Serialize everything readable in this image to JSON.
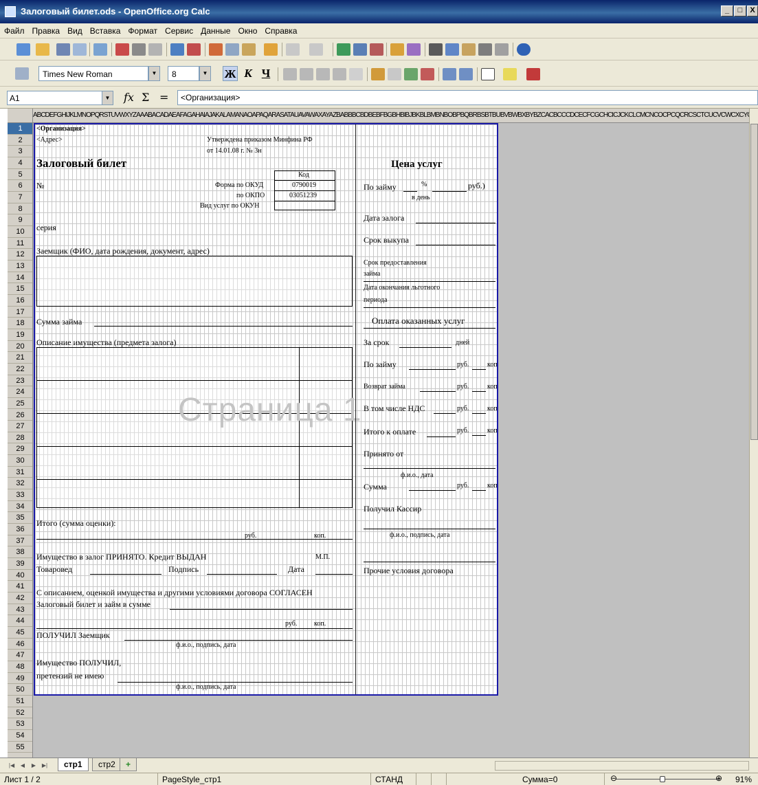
{
  "window": {
    "title": "Залоговый билет.ods - OpenOffice.org Calc",
    "min": "_",
    "max": "□",
    "close": "X"
  },
  "menu": [
    "Файл",
    "Правка",
    "Вид",
    "Вставка",
    "Формат",
    "Сервис",
    "Данные",
    "Окно",
    "Справка"
  ],
  "format_toolbar": {
    "font_name": "Times New Roman",
    "font_size": "8",
    "bold": "Ж",
    "italic": "К",
    "underline": "Ч"
  },
  "formula_bar": {
    "cell_ref": "A1",
    "fx": "fx",
    "sum": "Σ",
    "equals": "=",
    "content": "<Организация>"
  },
  "column_header_text": "ABCDEFGHIJKLMNOPQRSTUVWXYZAAABACADAEAFAGAHAIAJAKALAMANAOAPAQARASATAUAVAWAXAYAZBABBBCBDBEBFBGBHBIBJBKBLBMBNBOBPBQBRBSBTBUBVBWBXBYBZCACBCCCDCECFCGCHCICJCKCLCMCNCOCPCQCRCSCTCUCVCWCXCYCZDADBDCDDDEDFDGDHDIDJDKDLDMDNDODPDQDRDSDTDUDVDWDXDYDZEAEBECEDEEEFEGEHEIEJEKELEMENEOEPEQERESETEUEVEWEXEYEZ",
  "rows": [
    "1",
    "2",
    "3",
    "4",
    "5",
    "6",
    "7",
    "8",
    "9",
    "10",
    "11",
    "12",
    "13",
    "14",
    "15",
    "16",
    "17",
    "18",
    "19",
    "20",
    "21",
    "22",
    "23",
    "24",
    "25",
    "26",
    "27",
    "28",
    "29",
    "30",
    "31",
    "32",
    "33",
    "34",
    "35",
    "36",
    "37",
    "38",
    "39",
    "40",
    "41",
    "42",
    "43",
    "44",
    "45",
    "46",
    "47",
    "48",
    "49",
    "50",
    "51",
    "52",
    "53",
    "54",
    "55"
  ],
  "form": {
    "org": "<Организация>",
    "addr": "<Адрес>",
    "approved1": "Утверждена приказом Минфина РФ",
    "approved2": "от 14.01.08 г. № 3н",
    "title": "Залоговый билет",
    "kod": "Код",
    "num": "№",
    "okud_label": "Форма по ОКУД",
    "okud_val": "0790019",
    "okpo_label": "по ОКПО",
    "okpo_val": "03051239",
    "okun_label": "Вид услуг по ОКУН",
    "series": "серия",
    "borrower": "Заемщик (ФИО, дата рождения, документ, адрес)",
    "loan_sum": "Сумма займа",
    "desc": "Описание имущества (предмета залога)",
    "watermark": "Страница 1",
    "total": "Итого (сумма оценки):",
    "rub": "руб.",
    "kop": "коп.",
    "accepted": "Имущество в залог ПРИНЯТО. Кредит ВЫДАН",
    "mp": "М.П.",
    "merchandiser": "Товаровед",
    "signature": "Подпись",
    "date": "Дата",
    "agree": "С описанием, оценкой имущества и другими условиями договора СОГЛАСЕН",
    "ticket_sum": "Залоговый билет и займ в сумме",
    "received_borrower": "ПОЛУЧИЛ Заемщик",
    "fio_sig_date": "ф.и.о., подпись, дата",
    "received_property": "Имущество ПОЛУЧИЛ,",
    "no_claims": "претензий не имею",
    "price_title": "Цена услуг",
    "per_loan": "По займу",
    "percent": "%",
    "rub_paren": "руб.)",
    "per_day": "в день",
    "pledge_date": "Дата залога",
    "redeem_term": "Срок выкупа",
    "loan_term1": "Срок предоставления",
    "loan_term2": "займа",
    "grace_end1": "Дата окончания льготного",
    "grace_end2": "периода",
    "payment_title": "Оплата оказанных услуг",
    "for_term": "За срок",
    "days": "дней",
    "loan_return": "Возврат займа",
    "incl_vat": "В том числе НДС",
    "total_pay": "Итого к оплате",
    "received_from": "Принято от",
    "fio_date": "ф.и.о., дата",
    "sum": "Сумма",
    "cashier": "Получил Кассир",
    "fio_sig_date2": "ф.и.о., подпись, дата",
    "other_terms": "Прочие условия договора"
  },
  "sheet_tabs": {
    "tab1": "стр1",
    "tab2": "стр2",
    "add": "+"
  },
  "status": {
    "sheet": "Лист 1 / 2",
    "page_style": "PageStyle_стр1",
    "mode": "СТАНД",
    "sum": "Сумма=0",
    "zoom": "91%"
  }
}
